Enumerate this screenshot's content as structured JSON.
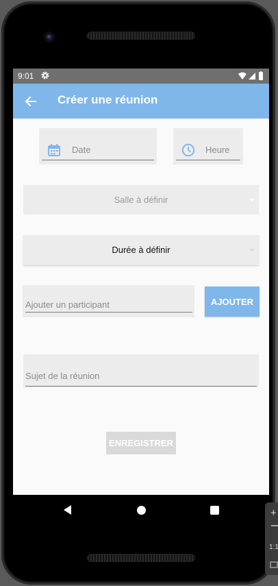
{
  "status_bar": {
    "time": "9:01"
  },
  "app_bar": {
    "title": "Créer une réunion"
  },
  "form": {
    "date_placeholder": "Date",
    "time_placeholder": "Heure",
    "room_spinner": "Salle à définir",
    "duration_spinner": "Durée à définir",
    "participant_placeholder": "Ajouter un participant",
    "add_button": "AJOUTER",
    "subject_placeholder": "Sujet de la réunion",
    "save_button": "ENREGISTRER"
  },
  "emulator_panel": {
    "plus": "+",
    "ratio": "1:1"
  },
  "icons": {
    "back": "arrow-back-icon",
    "date": "calendar-icon",
    "time": "clock-icon",
    "gear": "gear-icon"
  },
  "colors": {
    "accent": "#7fb7ea",
    "status_bar": "#6f6f6f",
    "field_background": "#ececec",
    "disabled_button": "#d9d9d9"
  }
}
